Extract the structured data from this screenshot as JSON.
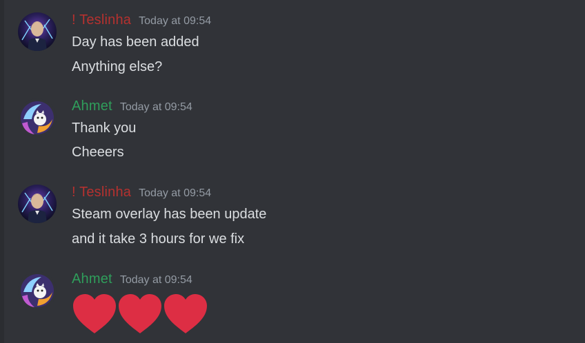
{
  "colors": {
    "background": "#313338",
    "teslinha_name": "#b5312f",
    "ahmet_name": "#2f9e5b",
    "heart": "#dd2e44",
    "message_text": "#dbdee1",
    "timestamp": "#949ba4"
  },
  "messages": [
    {
      "author": "! Teslinha",
      "timestamp": "Today at 09:54",
      "lines": [
        "Day has been added",
        "Anything else?"
      ]
    },
    {
      "author": "Ahmet",
      "timestamp": "Today at 09:54",
      "lines": [
        "Thank you",
        "Cheeers"
      ]
    },
    {
      "author": "! Teslinha",
      "timestamp": "Today at 09:54",
      "lines": [
        "Steam overlay has been update",
        "and it take 3 hours for we fix"
      ]
    },
    {
      "author": "Ahmet",
      "timestamp": "Today at 09:54",
      "emoji": [
        "heart-emoji",
        "heart-emoji",
        "heart-emoji"
      ]
    }
  ]
}
